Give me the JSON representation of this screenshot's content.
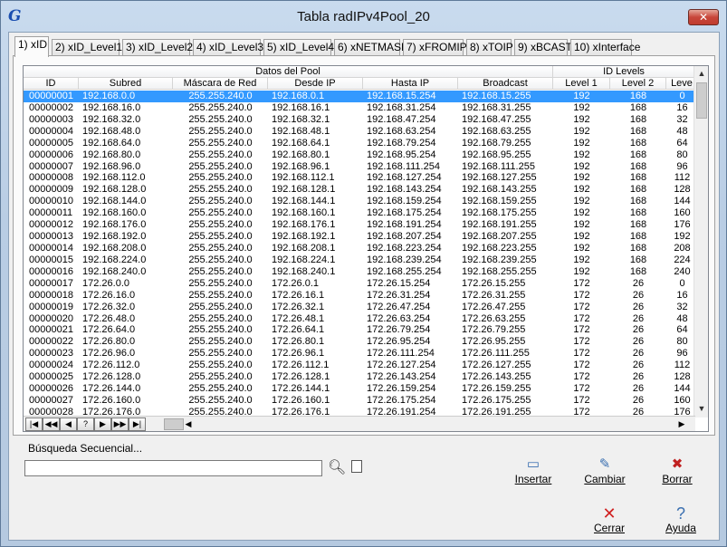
{
  "window": {
    "title": "Tabla radIPv4Pool_20"
  },
  "tabs": [
    {
      "label": "1) xID"
    },
    {
      "label": "2) xID_Level1"
    },
    {
      "label": "3) xID_Level2"
    },
    {
      "label": "4) xID_Level3"
    },
    {
      "label": "5) xID_Level4"
    },
    {
      "label": "6) xNETMASK"
    },
    {
      "label": "7) xFROMIP"
    },
    {
      "label": "8) xTOIP"
    },
    {
      "label": "9) xBCAST"
    },
    {
      "label": "10) xInterface"
    }
  ],
  "grid": {
    "group_headers": [
      "Datos del Pool",
      "ID Levels"
    ],
    "columns": [
      "ID",
      "Subred",
      "Máscara de Red",
      "Desde IP",
      "Hasta IP",
      "Broadcast",
      "Level 1",
      "Level 2",
      "Leve"
    ],
    "rows": [
      [
        "00000001",
        "192.168.0.0",
        "255.255.240.0",
        "192.168.0.1",
        "192.168.15.254",
        "192.168.15.255",
        "192",
        "168",
        "0"
      ],
      [
        "00000002",
        "192.168.16.0",
        "255.255.240.0",
        "192.168.16.1",
        "192.168.31.254",
        "192.168.31.255",
        "192",
        "168",
        "16"
      ],
      [
        "00000003",
        "192.168.32.0",
        "255.255.240.0",
        "192.168.32.1",
        "192.168.47.254",
        "192.168.47.255",
        "192",
        "168",
        "32"
      ],
      [
        "00000004",
        "192.168.48.0",
        "255.255.240.0",
        "192.168.48.1",
        "192.168.63.254",
        "192.168.63.255",
        "192",
        "168",
        "48"
      ],
      [
        "00000005",
        "192.168.64.0",
        "255.255.240.0",
        "192.168.64.1",
        "192.168.79.254",
        "192.168.79.255",
        "192",
        "168",
        "64"
      ],
      [
        "00000006",
        "192.168.80.0",
        "255.255.240.0",
        "192.168.80.1",
        "192.168.95.254",
        "192.168.95.255",
        "192",
        "168",
        "80"
      ],
      [
        "00000007",
        "192.168.96.0",
        "255.255.240.0",
        "192.168.96.1",
        "192.168.111.254",
        "192.168.111.255",
        "192",
        "168",
        "96"
      ],
      [
        "00000008",
        "192.168.112.0",
        "255.255.240.0",
        "192.168.112.1",
        "192.168.127.254",
        "192.168.127.255",
        "192",
        "168",
        "112"
      ],
      [
        "00000009",
        "192.168.128.0",
        "255.255.240.0",
        "192.168.128.1",
        "192.168.143.254",
        "192.168.143.255",
        "192",
        "168",
        "128"
      ],
      [
        "00000010",
        "192.168.144.0",
        "255.255.240.0",
        "192.168.144.1",
        "192.168.159.254",
        "192.168.159.255",
        "192",
        "168",
        "144"
      ],
      [
        "00000011",
        "192.168.160.0",
        "255.255.240.0",
        "192.168.160.1",
        "192.168.175.254",
        "192.168.175.255",
        "192",
        "168",
        "160"
      ],
      [
        "00000012",
        "192.168.176.0",
        "255.255.240.0",
        "192.168.176.1",
        "192.168.191.254",
        "192.168.191.255",
        "192",
        "168",
        "176"
      ],
      [
        "00000013",
        "192.168.192.0",
        "255.255.240.0",
        "192.168.192.1",
        "192.168.207.254",
        "192.168.207.255",
        "192",
        "168",
        "192"
      ],
      [
        "00000014",
        "192.168.208.0",
        "255.255.240.0",
        "192.168.208.1",
        "192.168.223.254",
        "192.168.223.255",
        "192",
        "168",
        "208"
      ],
      [
        "00000015",
        "192.168.224.0",
        "255.255.240.0",
        "192.168.224.1",
        "192.168.239.254",
        "192.168.239.255",
        "192",
        "168",
        "224"
      ],
      [
        "00000016",
        "192.168.240.0",
        "255.255.240.0",
        "192.168.240.1",
        "192.168.255.254",
        "192.168.255.255",
        "192",
        "168",
        "240"
      ],
      [
        "00000017",
        "172.26.0.0",
        "255.255.240.0",
        "172.26.0.1",
        "172.26.15.254",
        "172.26.15.255",
        "172",
        "26",
        "0"
      ],
      [
        "00000018",
        "172.26.16.0",
        "255.255.240.0",
        "172.26.16.1",
        "172.26.31.254",
        "172.26.31.255",
        "172",
        "26",
        "16"
      ],
      [
        "00000019",
        "172.26.32.0",
        "255.255.240.0",
        "172.26.32.1",
        "172.26.47.254",
        "172.26.47.255",
        "172",
        "26",
        "32"
      ],
      [
        "00000020",
        "172.26.48.0",
        "255.255.240.0",
        "172.26.48.1",
        "172.26.63.254",
        "172.26.63.255",
        "172",
        "26",
        "48"
      ],
      [
        "00000021",
        "172.26.64.0",
        "255.255.240.0",
        "172.26.64.1",
        "172.26.79.254",
        "172.26.79.255",
        "172",
        "26",
        "64"
      ],
      [
        "00000022",
        "172.26.80.0",
        "255.255.240.0",
        "172.26.80.1",
        "172.26.95.254",
        "172.26.95.255",
        "172",
        "26",
        "80"
      ],
      [
        "00000023",
        "172.26.96.0",
        "255.255.240.0",
        "172.26.96.1",
        "172.26.111.254",
        "172.26.111.255",
        "172",
        "26",
        "96"
      ],
      [
        "00000024",
        "172.26.112.0",
        "255.255.240.0",
        "172.26.112.1",
        "172.26.127.254",
        "172.26.127.255",
        "172",
        "26",
        "112"
      ],
      [
        "00000025",
        "172.26.128.0",
        "255.255.240.0",
        "172.26.128.1",
        "172.26.143.254",
        "172.26.143.255",
        "172",
        "26",
        "128"
      ],
      [
        "00000026",
        "172.26.144.0",
        "255.255.240.0",
        "172.26.144.1",
        "172.26.159.254",
        "172.26.159.255",
        "172",
        "26",
        "144"
      ],
      [
        "00000027",
        "172.26.160.0",
        "255.255.240.0",
        "172.26.160.1",
        "172.26.175.254",
        "172.26.175.255",
        "172",
        "26",
        "160"
      ],
      [
        "00000028",
        "172.26.176.0",
        "255.255.240.0",
        "172.26.176.1",
        "172.26.191.254",
        "172.26.191.255",
        "172",
        "26",
        "176"
      ]
    ],
    "selected_row": 0,
    "nav_buttons": [
      "|◀",
      "◀◀",
      "◀",
      "?",
      "▶",
      "▶▶",
      "▶|"
    ]
  },
  "search": {
    "label": "Búsqueda Secuencial...",
    "value": ""
  },
  "actions": {
    "insert": "Insertar",
    "change": "Cambiar",
    "delete": "Borrar"
  },
  "footer": {
    "close": "Cerrar",
    "help": "Ayuda"
  },
  "colors": {
    "selection": "#3399ff",
    "accent": "#1b4fb0"
  }
}
